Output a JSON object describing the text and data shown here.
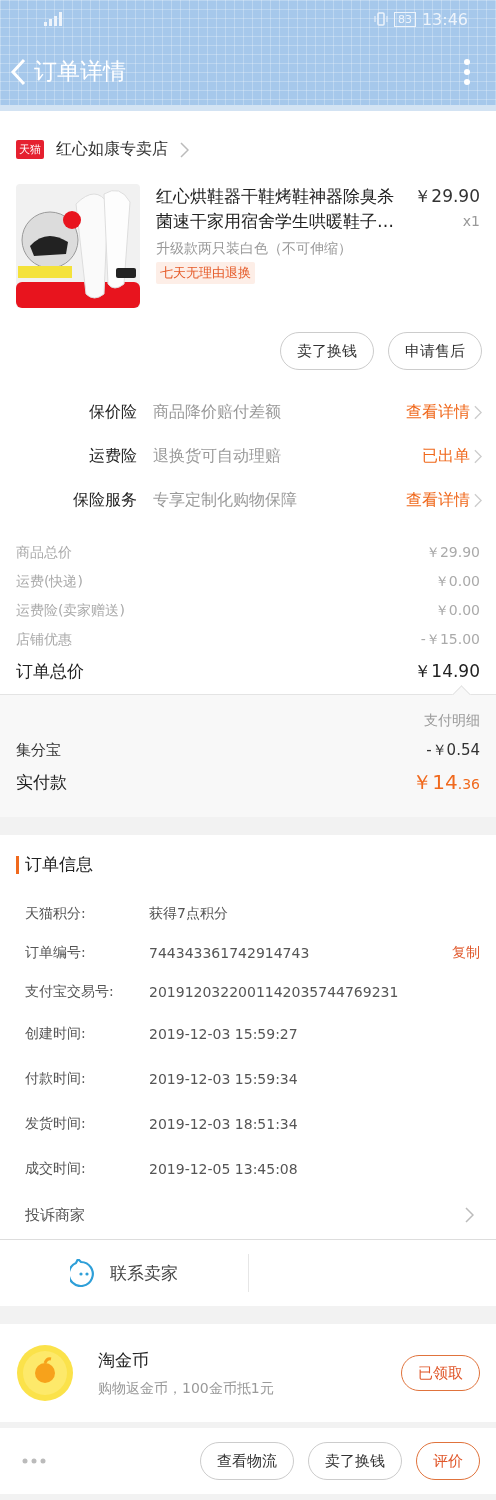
{
  "status_bar": {
    "battery": "83",
    "time": "13:46"
  },
  "nav": {
    "title": "订单详情"
  },
  "store": {
    "badge": "天猫",
    "name": "红心如康专卖店"
  },
  "product": {
    "title": "红心烘鞋器干鞋烤鞋神器除臭杀菌速干家用宿舍学生哄暖鞋子…",
    "price": "￥29.90",
    "quantity": "x1",
    "sku": "升级款两只装白色（不可伸缩）",
    "tag": "七天无理由退换"
  },
  "product_actions": [
    "卖了换钱",
    "申请售后"
  ],
  "insurance": [
    {
      "label": "保价险",
      "description": "商品降价赔付差额",
      "action": "查看详情"
    },
    {
      "label": "运费险",
      "description": "退换货可自动理赔",
      "action": "已出单"
    },
    {
      "label": "保险服务",
      "description": "专享定制化购物保障",
      "action": "查看详情"
    }
  ],
  "prices": [
    {
      "label": "商品总价",
      "value": "￥29.90"
    },
    {
      "label": "运费(快递)",
      "value": "￥0.00"
    },
    {
      "label": "运费险(卖家赠送)",
      "value": "￥0.00"
    },
    {
      "label": "店铺优惠",
      "value": "-￥15.00"
    }
  ],
  "order_total": {
    "label": "订单总价",
    "value": "￥14.90"
  },
  "payment": {
    "link": "支付明细",
    "rows": [
      {
        "label": "集分宝",
        "value": "-￥0.54"
      }
    ],
    "paid": {
      "label": "实付款",
      "main": "￥14",
      "fraction": ".36"
    }
  },
  "order_info": {
    "title": "订单信息",
    "rows": [
      {
        "label": "天猫积分:",
        "value": "获得7点积分"
      },
      {
        "label": "订单编号:",
        "value": "744343361742914743",
        "action": "复制"
      },
      {
        "label": "支付宝交易号:",
        "value": "2019120322001142035744769231"
      },
      {
        "label": "创建时间:",
        "value": "2019-12-03 15:59:27"
      },
      {
        "label": "付款时间:",
        "value": "2019-12-03 15:59:34"
      },
      {
        "label": "发货时间:",
        "value": "2019-12-03 18:51:34"
      },
      {
        "label": "成交时间:",
        "value": "2019-12-05 13:45:08"
      }
    ],
    "complaint": "投诉商家"
  },
  "contact": {
    "label": "联系卖家"
  },
  "coin": {
    "title": "淘金币",
    "description": "购物返金币，100金币抵1元",
    "button": "已领取"
  },
  "bottom_bar": {
    "buttons": [
      {
        "label": "查看物流",
        "kind": "outline"
      },
      {
        "label": "卖了换钱",
        "kind": "outline"
      },
      {
        "label": "评价",
        "kind": "accent"
      }
    ]
  }
}
